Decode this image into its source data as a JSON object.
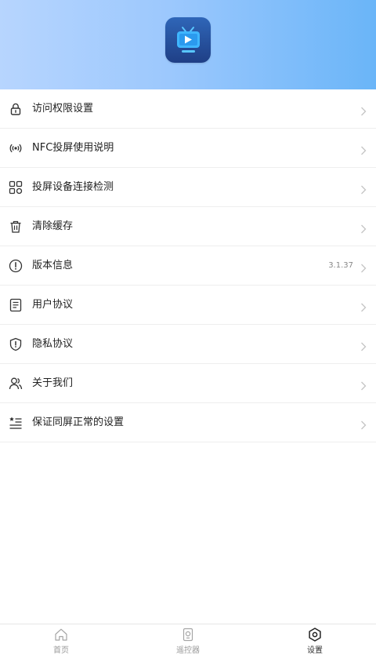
{
  "menu": {
    "items": [
      {
        "label": "访问权限设置",
        "icon": "lock-icon"
      },
      {
        "label": "NFC投屏使用说明",
        "icon": "nfc-icon"
      },
      {
        "label": "投屏设备连接检测",
        "icon": "devices-icon"
      },
      {
        "label": "清除缓存",
        "icon": "trash-icon"
      },
      {
        "label": "版本信息",
        "icon": "info-icon",
        "value": "3.1.37"
      },
      {
        "label": "用户协议",
        "icon": "document-icon"
      },
      {
        "label": "隐私协议",
        "icon": "shield-icon"
      },
      {
        "label": "关于我们",
        "icon": "users-icon"
      },
      {
        "label": "保证同屏正常的设置",
        "icon": "list-settings-icon"
      }
    ]
  },
  "tabbar": {
    "tabs": [
      {
        "label": "首页",
        "icon": "home-icon"
      },
      {
        "label": "遥控器",
        "icon": "remote-icon"
      },
      {
        "label": "设置",
        "icon": "settings-icon",
        "active": true
      }
    ]
  },
  "colors": {
    "header_start": "#b7d5fe",
    "header_end": "#6ab5f8",
    "logo": "#2f66b8",
    "logo_screen": "#3fb6ff"
  }
}
